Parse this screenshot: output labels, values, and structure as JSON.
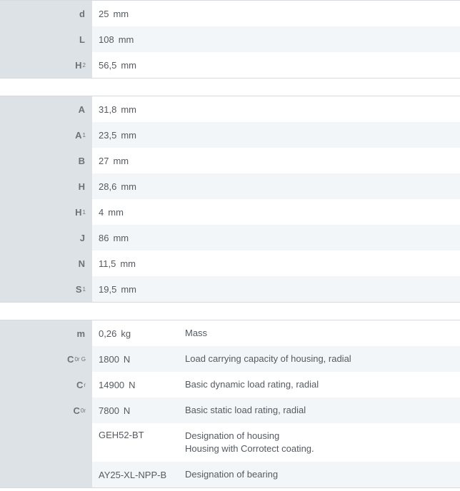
{
  "group1": [
    {
      "symbol": "d",
      "sub": "",
      "value": "25",
      "unit": "mm"
    },
    {
      "symbol": "L",
      "sub": "",
      "value": "108",
      "unit": "mm"
    },
    {
      "symbol": "H",
      "sub": "2",
      "value": "56,5",
      "unit": "mm"
    }
  ],
  "group2": [
    {
      "symbol": "A",
      "sub": "",
      "value": "31,8",
      "unit": "mm"
    },
    {
      "symbol": "A",
      "sub": "1",
      "value": "23,5",
      "unit": "mm"
    },
    {
      "symbol": "B",
      "sub": "",
      "value": "27",
      "unit": "mm"
    },
    {
      "symbol": "H",
      "sub": "",
      "value": "28,6",
      "unit": "mm"
    },
    {
      "symbol": "H",
      "sub": "1",
      "value": "4",
      "unit": "mm"
    },
    {
      "symbol": "J",
      "sub": "",
      "value": "86",
      "unit": "mm"
    },
    {
      "symbol": "N",
      "sub": "",
      "value": "11,5",
      "unit": "mm"
    },
    {
      "symbol": "S",
      "sub": "1",
      "value": "19,5",
      "unit": "mm"
    }
  ],
  "group3": [
    {
      "symbol": "m",
      "sub": "",
      "value": "0,26",
      "unit": "kg",
      "desc": [
        "Mass"
      ]
    },
    {
      "symbol": "C",
      "sub": "0r G",
      "value": "1800",
      "unit": "N",
      "desc": [
        "Load carrying capacity of housing, radial"
      ]
    },
    {
      "symbol": "C",
      "sub": "r",
      "value": "14900",
      "unit": "N",
      "desc": [
        "Basic dynamic load rating, radial"
      ]
    },
    {
      "symbol": "C",
      "sub": "0r",
      "value": "7800",
      "unit": "N",
      "desc": [
        "Basic static load rating, radial"
      ]
    },
    {
      "symbol": "",
      "sub": "",
      "value": "GEH52-BT",
      "unit": "",
      "desc": [
        "Designation of housing",
        "Housing with Corrotect coating."
      ]
    },
    {
      "symbol": "",
      "sub": "",
      "value": "AY25-XL-NPP-B",
      "unit": "",
      "desc": [
        "Designation of bearing"
      ]
    }
  ]
}
